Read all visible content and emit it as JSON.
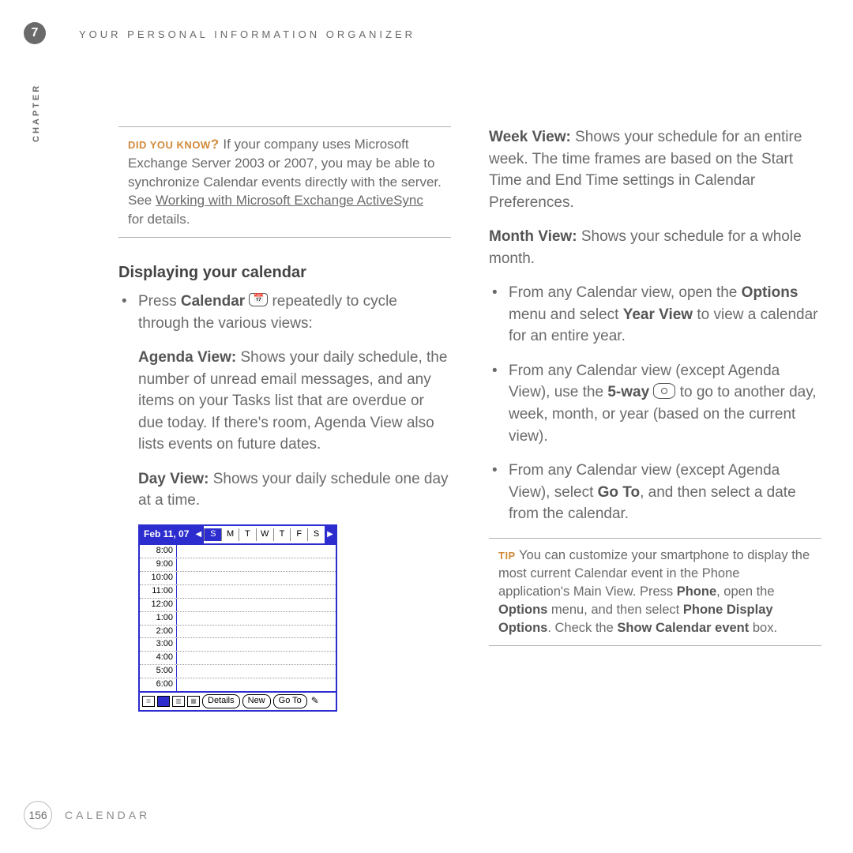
{
  "header": {
    "chapter_number": "7",
    "running_head": "YOUR PERSONAL INFORMATION ORGANIZER",
    "chapter_label": "CHAPTER"
  },
  "left": {
    "dyk_label": "DID YOU KNOW",
    "dyk_q": "?",
    "dyk_text_a": "If your company uses Microsoft Exchange Server 2003 or 2007, you may be able to synchronize Calendar events directly with the server. See ",
    "dyk_link": "Working with Microsoft Exchange ActiveSync",
    "dyk_text_b": " for details.",
    "section_title": "Displaying your calendar",
    "b1_a": "Press ",
    "b1_strong": "Calendar",
    "b1_icon_label": "📅",
    "b1_b": " repeatedly to cycle through the various views:",
    "agenda_k": "Agenda View:",
    "agenda_t": " Shows your daily schedule, the number of unread email messages, and any items on your Tasks list that are overdue or due today. If there's room, Agenda View also lists events on future dates.",
    "day_k": "Day View:",
    "day_t": " Shows your daily schedule one day at a time."
  },
  "shot": {
    "date": "Feb 11, 07",
    "days": [
      "S",
      "M",
      "T",
      "W",
      "T",
      "F",
      "S"
    ],
    "selected_day_index": 0,
    "times": [
      "8:00",
      "9:00",
      "10:00",
      "11:00",
      "12:00",
      "1:00",
      "2:00",
      "3:00",
      "4:00",
      "5:00",
      "6:00"
    ],
    "buttons": [
      "Details",
      "New",
      "Go To"
    ]
  },
  "right": {
    "week_k": "Week View:",
    "week_t": " Shows your schedule for an entire week. The time frames are based on the Start Time and End Time settings in Calendar Preferences.",
    "month_k": "Month View:",
    "month_t": " Shows your schedule for a whole month.",
    "b1_a": "From any Calendar view, open the ",
    "b1_s1": "Options",
    "b1_b": " menu and select ",
    "b1_s2": "Year View",
    "b1_c": " to view a calendar for an entire year.",
    "b2_a": "From any Calendar view (except Agenda View), use the ",
    "b2_s1": "5-way",
    "b2_b": " to go to another day, week, month, or year (based on the current view).",
    "b3_a": "From any Calendar view (except Agenda View), select ",
    "b3_s1": "Go To",
    "b3_b": ", and then select a date from the calendar.",
    "tip_label": "TIP",
    "tip_a": "You can customize your smartphone to display the most current Calendar event in the Phone application's Main View. Press ",
    "tip_s1": "Phone",
    "tip_b": ", open the ",
    "tip_s2": "Options",
    "tip_c": " menu, and then select ",
    "tip_s3": "Phone Display Options",
    "tip_d": ". Check the ",
    "tip_s4": "Show Calendar event",
    "tip_e": " box."
  },
  "footer": {
    "page": "156",
    "section": "CALENDAR"
  }
}
